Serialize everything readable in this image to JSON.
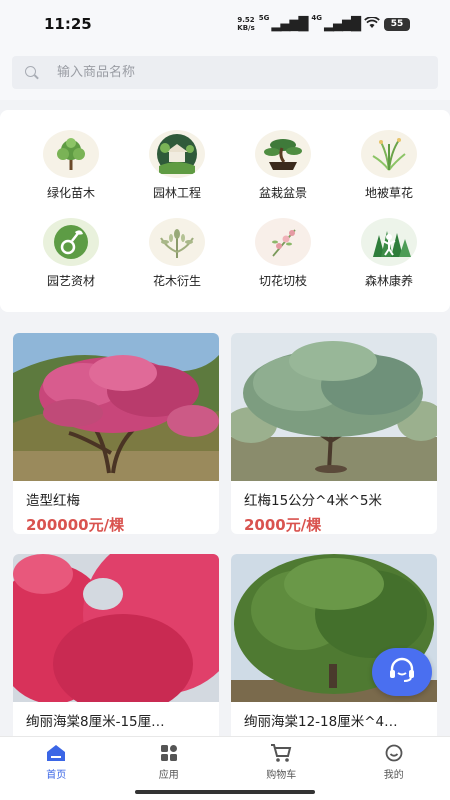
{
  "status": {
    "time": "11:25",
    "net_speed_value": "9.52",
    "net_speed_unit": "KB/s",
    "signal1_label": "5G",
    "signal2_label": "4G",
    "battery": "55"
  },
  "search": {
    "placeholder": "输入商品名称"
  },
  "categories": [
    {
      "label": "绿化苗木",
      "icon": "tree-icon"
    },
    {
      "label": "园林工程",
      "icon": "garden-pavilion-icon"
    },
    {
      "label": "盆栽盆景",
      "icon": "bonsai-icon"
    },
    {
      "label": "地被草花",
      "icon": "grass-flower-icon"
    },
    {
      "label": "园艺资材",
      "icon": "gardening-supplies-icon"
    },
    {
      "label": "花木衍生",
      "icon": "plant-derivative-icon"
    },
    {
      "label": "切花切枝",
      "icon": "cut-flower-icon"
    },
    {
      "label": "森林康养",
      "icon": "forest-wellness-icon"
    }
  ],
  "products": [
    {
      "name": "造型红梅",
      "price": "200000元/棵"
    },
    {
      "name": "红梅15公分^4米^5米",
      "price": "2000元/棵"
    },
    {
      "name": "绚丽海棠8厘米-15厘…",
      "price": ""
    },
    {
      "name": "绚丽海棠12-18厘米^4…",
      "price": ""
    }
  ],
  "tabs": [
    {
      "label": "首页",
      "icon": "home-icon"
    },
    {
      "label": "应用",
      "icon": "apps-icon"
    },
    {
      "label": "购物车",
      "icon": "cart-icon"
    },
    {
      "label": "我的",
      "icon": "profile-icon"
    }
  ],
  "colors": {
    "accent": "#3b66e6",
    "price": "#d9534f",
    "fab": "#4a6ff0"
  }
}
